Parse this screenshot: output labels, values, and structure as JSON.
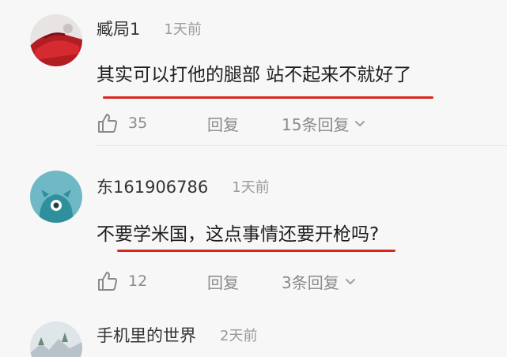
{
  "comments": [
    {
      "username": "臧局1",
      "time": "1天前",
      "text": "其实可以打他的腿部 站不起来不就好了",
      "likes": "35",
      "reply_label": "回复",
      "replies_label": "15条回复",
      "avatar_icon": "red-car-avatar"
    },
    {
      "username": "东161906786",
      "time": "1天前",
      "text": "不要学米国，这点事情还要开枪吗?",
      "likes": "12",
      "reply_label": "回复",
      "replies_label": "3条回复",
      "avatar_icon": "teal-monster-avatar"
    },
    {
      "username": "手机里的世界",
      "time": "2天前",
      "avatar_icon": "landscape-avatar"
    }
  ],
  "colors": {
    "underline": "#d9261c",
    "text": "#1e1e1e",
    "muted": "#8a8a8a"
  }
}
